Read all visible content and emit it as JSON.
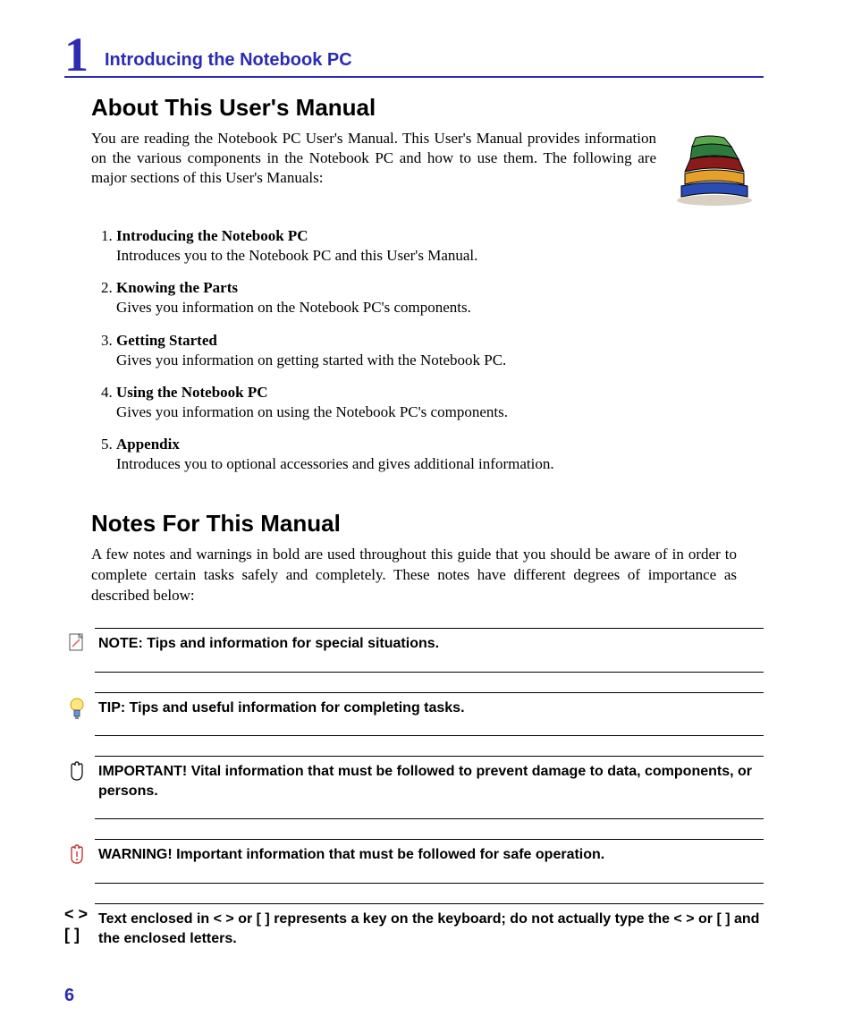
{
  "header": {
    "chapter_number": "1",
    "chapter_title": "Introducing the Notebook PC"
  },
  "about": {
    "heading": "About This User's Manual",
    "intro": "You are reading the Notebook PC User's Manual. This User's Manual provides information on the various components in the Notebook PC and how to use them. The following are major sections of this User's Manuals:",
    "sections": [
      {
        "title": "Introducing the Notebook PC",
        "desc": "Introduces you to the Notebook PC and this User's Manual."
      },
      {
        "title": "Knowing the Parts",
        "desc": "Gives you information on the Notebook PC's components."
      },
      {
        "title": "Getting Started",
        "desc": "Gives you information on getting started with the Notebook PC."
      },
      {
        "title": "Using the Notebook PC",
        "desc": "Gives you information on using the Notebook PC's components."
      },
      {
        "title": "Appendix",
        "desc": "Introduces you to optional accessories and gives additional information."
      }
    ]
  },
  "notes": {
    "heading": "Notes For This Manual",
    "intro": "A few notes and warnings in bold are used throughout this guide that you should be aware of in order to complete certain tasks safely and completely. These notes have different degrees of importance as described below:",
    "items": [
      {
        "icon": "note-page-icon",
        "text": "NOTE: Tips and information for special situations."
      },
      {
        "icon": "tip-bulb-icon",
        "text": "TIP: Tips and useful information for completing tasks."
      },
      {
        "icon": "important-hand-icon",
        "text": "IMPORTANT! Vital information that must be followed to prevent damage to data, components, or persons."
      },
      {
        "icon": "warning-hand-icon",
        "text": "WARNING! Important information that must be followed for safe operation."
      }
    ],
    "key_symbols": {
      "line1": "< >",
      "line2": "[  ]"
    },
    "key_text": "Text enclosed in < > or [ ] represents a key on the keyboard; do not actually type the < > or [ ] and the enclosed letters."
  },
  "page_number": "6"
}
